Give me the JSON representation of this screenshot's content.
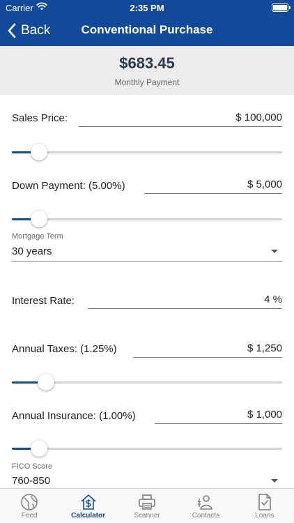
{
  "status_bar": {
    "carrier": "Carrier",
    "time": "2:35 PM"
  },
  "nav": {
    "back_label": "Back",
    "title": "Conventional Purchase"
  },
  "summary": {
    "amount": "$683.45",
    "label": "Monthly Payment"
  },
  "fields": {
    "sales_price": {
      "label": "Sales Price:",
      "value": "$ 100,000",
      "slider_percent": 10
    },
    "down_payment": {
      "label": "Down Payment: (5.00%)",
      "value": "$ 5,000",
      "slider_percent": 10
    },
    "mortgage_term": {
      "label": "Mortgage Term",
      "value": "30 years"
    },
    "interest_rate": {
      "label": "Interest Rate:",
      "value": "4 %"
    },
    "annual_taxes": {
      "label": "Annual Taxes: (1.25%)",
      "value": "$ 1,250",
      "slider_percent": 12.5
    },
    "annual_insurance": {
      "label": "Annual Insurance: (1.00%)",
      "value": "$ 1,000",
      "slider_percent": 10
    },
    "fico_score": {
      "label": "FICO Score",
      "value": "760-850"
    }
  },
  "tabs": [
    {
      "label": "Feed",
      "icon": "globe-icon",
      "active": false
    },
    {
      "label": "Calculator",
      "icon": "house-dollar-icon",
      "active": true
    },
    {
      "label": "Scanner",
      "icon": "printer-icon",
      "active": false
    },
    {
      "label": "Contacts",
      "icon": "contacts-icon",
      "active": false
    },
    {
      "label": "Loans",
      "icon": "document-check-icon",
      "active": false
    }
  ],
  "colors": {
    "brand": "#114a9a",
    "summary_bg": "#ececec",
    "inactive_tab": "#7d7d7d"
  }
}
